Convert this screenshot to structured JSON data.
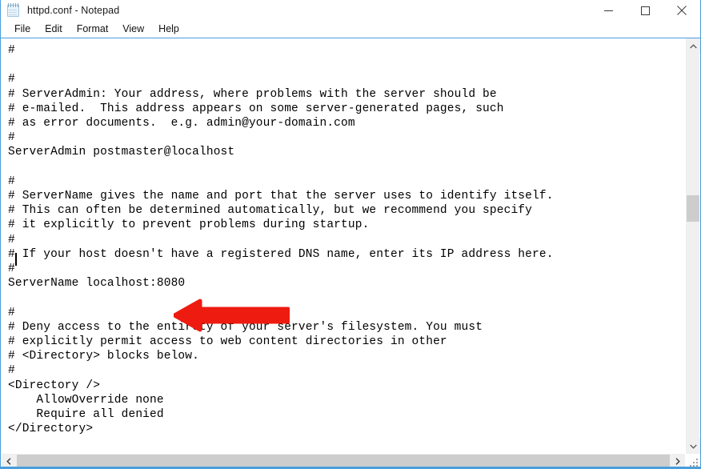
{
  "window": {
    "title": "httpd.conf - Notepad",
    "icon": "notepad-icon",
    "frame_color": "#4a9edb",
    "controls": {
      "minimize": "Minimize",
      "maximize": "Maximize",
      "close": "Close"
    }
  },
  "menubar": {
    "items": [
      {
        "label": "File"
      },
      {
        "label": "Edit"
      },
      {
        "label": "Format"
      },
      {
        "label": "View"
      },
      {
        "label": "Help"
      }
    ]
  },
  "editor": {
    "filename": "httpd.conf",
    "caret_line": 19,
    "caret_column": 2,
    "content": "#\n\n#\n# ServerAdmin: Your address, where problems with the server should be\n# e-mailed.  This address appears on some server-generated pages, such\n# as error documents.  e.g. admin@your-domain.com\n#\nServerAdmin postmaster@localhost\n\n#\n# ServerName gives the name and port that the server uses to identify itself.\n# This can often be determined automatically, but we recommend you specify\n# it explicitly to prevent problems during startup.\n#\n# If your host doesn't have a registered DNS name, enter its IP address here.\n#\nServerName localhost:8080\n\n#\n# Deny access to the entirety of your server's filesystem. You must\n# explicitly permit access to web content directories in other\n# <Directory> blocks below.\n#\n<Directory />\n    AllowOverride none\n    Require all denied\n</Directory>"
  },
  "annotation": {
    "type": "arrow-left",
    "color": "#ee1b11",
    "points_at": "ServerName localhost:8080"
  },
  "scrollbars": {
    "vertical": {
      "up_arrow": "scroll-up",
      "down_arrow": "scroll-down",
      "thumb_position_percent": 40
    },
    "horizontal": {
      "left_arrow": "scroll-left",
      "right_arrow": "scroll-right",
      "thumb_position_percent": 0
    }
  }
}
